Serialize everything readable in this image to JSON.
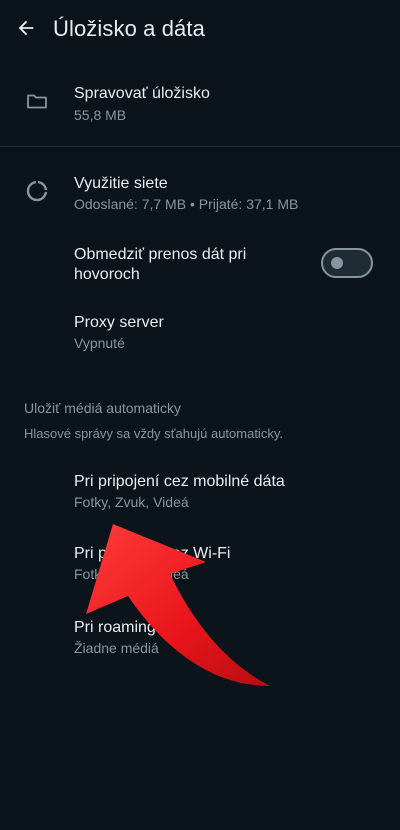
{
  "header": {
    "title": "Úložisko a dáta",
    "back_icon": "arrow-left-icon"
  },
  "storage": {
    "label": "Spravovať úložisko",
    "value": "55,8 MB",
    "icon": "folder-icon"
  },
  "network": {
    "label": "Využitie siete",
    "value": "Odoslané: 7,7 MB • Prijaté: 37,1 MB",
    "icon": "data-usage-icon"
  },
  "call_data": {
    "label_line1": "Obmedziť prenos dát pri",
    "label_line2": "hovoroch",
    "enabled": false
  },
  "proxy": {
    "label": "Proxy server",
    "value": "Vypnuté"
  },
  "media_section": {
    "title": "Uložiť médiá automaticky",
    "note": "Hlasové správy sa vždy sťahujú automaticky.",
    "items": [
      {
        "label": "Pri pripojení cez mobilné dáta",
        "value": "Fotky, Zvuk, Videá"
      },
      {
        "label": "Pri pripojení cez Wi-Fi",
        "value": "Fotky, Zvuk, Videá"
      },
      {
        "label": "Pri roamingu",
        "value": "Žiadne médiá"
      }
    ]
  },
  "colors": {
    "background": "#0b141a",
    "primary_text": "#e9edef",
    "secondary_text": "#8696a0",
    "arrow": "#e8151b"
  }
}
